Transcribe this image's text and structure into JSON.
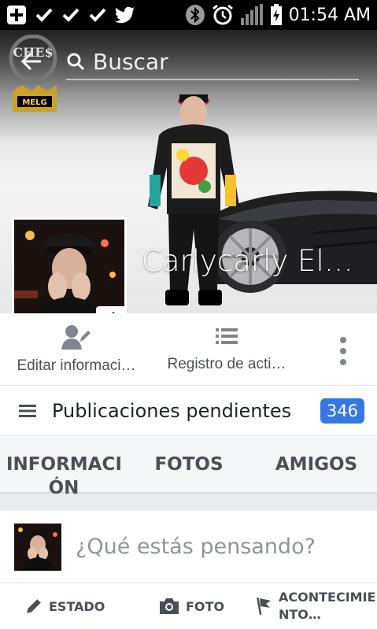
{
  "status_bar": {
    "time": "01:54 AM",
    "left_icons": [
      "add-box-icon",
      "check-icon",
      "check-icon",
      "check-icon",
      "twitter-bird-icon"
    ],
    "right_icons": [
      "bluetooth-icon",
      "alarm-icon",
      "signal-icon",
      "battery-charging-icon"
    ]
  },
  "header": {
    "search_placeholder": "Buscar",
    "logo_text": "CHE$",
    "logo2_text": "MELG"
  },
  "profile": {
    "name": "Carlycarly Eldelatintainfini…"
  },
  "actions": [
    {
      "label": "Editar informaci…",
      "icon": "edit-profile-icon"
    },
    {
      "label": "Registro de acti…",
      "icon": "activity-log-icon"
    }
  ],
  "pending": {
    "label": "Publicaciones pendientes",
    "count": "346",
    "badge_color": "#3578e5"
  },
  "tabs": [
    {
      "line1": "INFORMACI",
      "line2": "ÓN"
    },
    {
      "line1": "FOTOS"
    },
    {
      "line1": "AMIGOS"
    }
  ],
  "composer": {
    "placeholder": "¿Qué estás pensando?"
  },
  "post_actions": [
    {
      "label": "ESTADO",
      "icon": "pencil-icon"
    },
    {
      "label": "FOTO",
      "icon": "camera-icon"
    },
    {
      "line1": "ACONTECIMIE",
      "line2": "NTO…",
      "icon": "flag-icon"
    }
  ]
}
